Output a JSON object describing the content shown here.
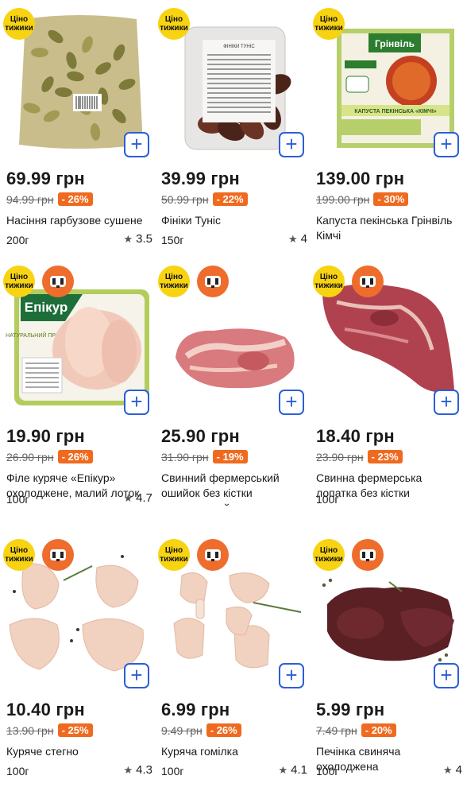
{
  "badge": {
    "cheap_line1": "Ціно",
    "cheap_line2": "тижики"
  },
  "products": [
    {
      "price": "69.99 грн",
      "old_price": "94.99 грн",
      "discount": "- 26%",
      "name": "Насіння гарбузове сушене",
      "weight": "200г",
      "rating": "3.5",
      "meat_badge": false,
      "image": "pumpkin-seeds"
    },
    {
      "price": "39.99 грн",
      "old_price": "50.99 грн",
      "discount": "- 22%",
      "name": "Фініки Туніс",
      "weight": "150г",
      "rating": "4",
      "meat_badge": false,
      "image": "dates",
      "image_text": "ФІНІКИ ТУНІС"
    },
    {
      "price": "139.00 грн",
      "old_price": "199.00 грн",
      "discount": "- 30%",
      "name": "Капуста пекінська Грінвіль Кімчі",
      "weight": "",
      "rating": "",
      "meat_badge": false,
      "image": "kimchi",
      "image_text": "Грінвіль",
      "image_text2": "КАПУСТА ПЕКІНСЬКА «КІМЧІ»"
    },
    {
      "price": "19.90 грн",
      "old_price": "26.90 грн",
      "discount": "- 26%",
      "name": "Філе куряче «Епікур» охолоджене, малий лоток",
      "weight": "100г",
      "rating": "4.7",
      "meat_badge": true,
      "image": "chicken-fillet",
      "image_text": "Епікур",
      "image_text2": "НАТУРАЛЬНИЙ ПРОДУКТ"
    },
    {
      "price": "25.90 грн",
      "old_price": "31.90 грн",
      "discount": "- 19%",
      "name": "Свинний фермерський ошийок без кістки охолоджений",
      "weight": "",
      "rating": "",
      "meat_badge": true,
      "image": "pork-neck"
    },
    {
      "price": "18.40 грн",
      "old_price": "23.90 грн",
      "discount": "- 23%",
      "name": "Свинна фермерська лопатка без кістки охолоджена",
      "weight": "100г",
      "rating": "",
      "meat_badge": true,
      "image": "pork-shoulder"
    },
    {
      "price": "10.40 грн",
      "old_price": "13.90 грн",
      "discount": "- 25%",
      "name": "Куряче стегно",
      "weight": "100г",
      "rating": "4.3",
      "meat_badge": true,
      "image": "chicken-thigh"
    },
    {
      "price": "6.99 грн",
      "old_price": "9.49 грн",
      "discount": "- 26%",
      "name": "Куряча гомілка",
      "weight": "100г",
      "rating": "4.1",
      "meat_badge": true,
      "image": "chicken-drumstick"
    },
    {
      "price": "5.99 грн",
      "old_price": "7.49 грн",
      "discount": "- 20%",
      "name": "Печінка свиняча охолоджена",
      "weight": "100г",
      "rating": "4",
      "meat_badge": true,
      "image": "pork-liver"
    }
  ],
  "colors": {
    "accent": "#2a5fd8",
    "discount": "#ef6a1f",
    "badge_yellow": "#f8d312",
    "badge_orange": "#ee6d2c"
  },
  "icons": {
    "add": "plus-icon",
    "rating": "star-icon",
    "meat": "meat-face-icon"
  }
}
